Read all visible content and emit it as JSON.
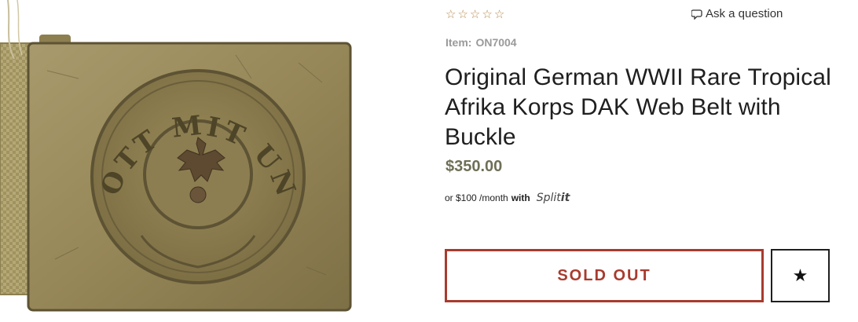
{
  "product": {
    "rating": {
      "value": 0,
      "max": 5,
      "star_char": "☆"
    },
    "ask_question": "Ask a question",
    "item_label": "Item:",
    "item_code": "ON7004",
    "title": "Original German WWII Rare Tropical Afrika Korps DAK Web Belt with Buckle",
    "price": "$350.00",
    "financing": {
      "prefix": "or $100 /month",
      "with": "with",
      "brand_regular": "Split",
      "brand_bold": "it"
    },
    "sold_out_label": "SOLD OUT",
    "wishlist_icon": "star-icon"
  },
  "image": {
    "buckle_inscription": "GOTT MIT UNS"
  },
  "colors": {
    "accent_red": "#a83b2e",
    "price": "#6f6f57",
    "star": "#b78a4b"
  }
}
